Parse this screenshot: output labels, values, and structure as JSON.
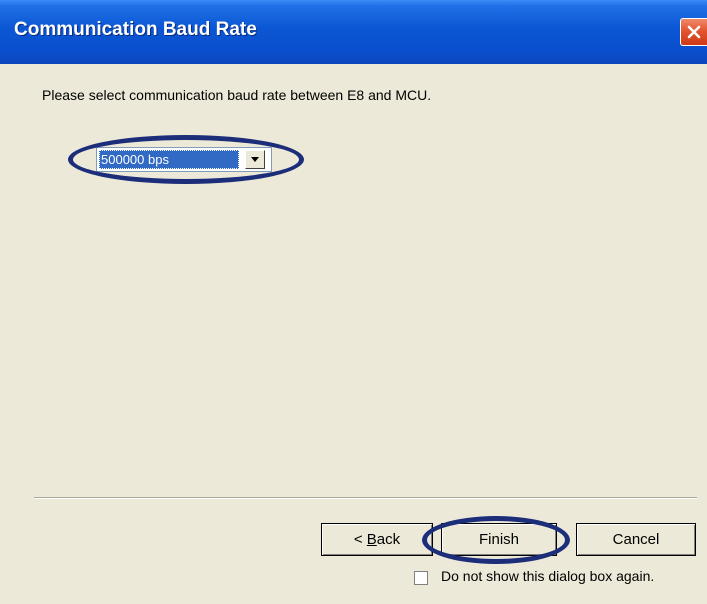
{
  "window": {
    "title": "Communication Baud Rate"
  },
  "dialog": {
    "prompt": "Please select communication baud rate between E8 and MCU.",
    "baud_rate": {
      "selected": "500000 bps"
    },
    "buttons": {
      "back_prefix": "< ",
      "back_mnemonic": "B",
      "back_rest": "ack",
      "finish": "Finish",
      "cancel": "Cancel"
    },
    "checkbox": {
      "label": "Do not show this dialog box again.",
      "checked": false
    }
  },
  "icons": {
    "close": "close-icon",
    "dropdown": "chevron-down-icon"
  },
  "colors": {
    "titlebar": "#0a4fcd",
    "dialog_bg": "#ece9d8",
    "selection": "#316ac5",
    "annotation": "#1c2e7a",
    "close_button": "#e2552f"
  }
}
